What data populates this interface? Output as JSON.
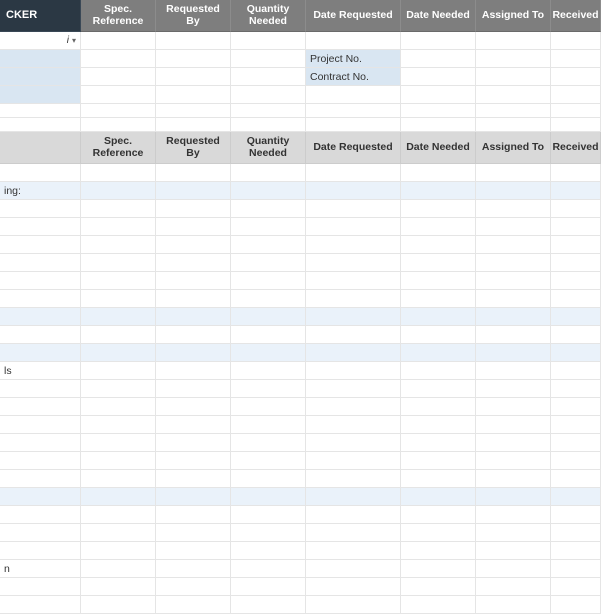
{
  "header_dark": {
    "title": "CKER",
    "columns": [
      "Spec. Reference",
      "Requested By",
      "Quantity Needed",
      "Date Requested",
      "Date Needed",
      "Assigned To",
      "Received"
    ]
  },
  "filter": {
    "symbol": "i",
    "dropdown": "▾"
  },
  "info_labels": {
    "project": "Project No.",
    "contract": "Contract No."
  },
  "header_light": {
    "columns": [
      "Spec. Reference",
      "Requested By",
      "Quantity Needed",
      "Date Requested",
      "Date Needed",
      "Assigned To",
      "Received"
    ]
  },
  "section_labels": {
    "ing": "ing:",
    "ls": "ls",
    "n": "n"
  }
}
